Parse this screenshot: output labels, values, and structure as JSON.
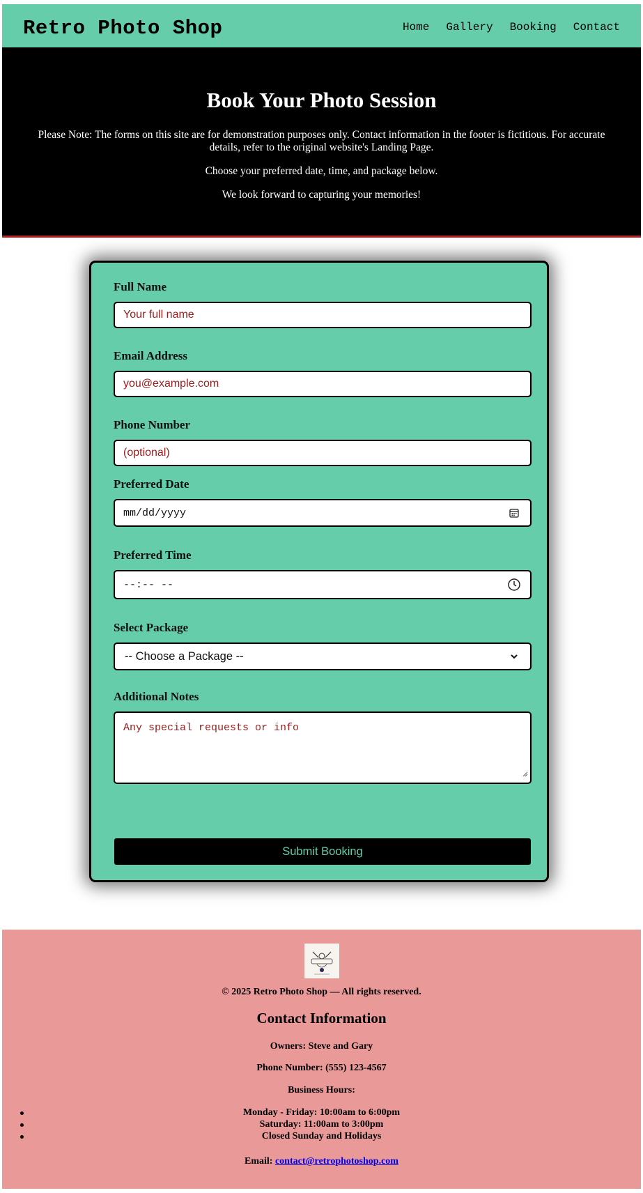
{
  "header": {
    "brand": "Retro Photo Shop",
    "nav": [
      "Home",
      "Gallery",
      "Booking",
      "Contact"
    ]
  },
  "hero": {
    "title": "Book Your Photo Session",
    "note": "Please Note: The forms on this site are for demonstration purposes only. Contact information in the footer is fictitious. For accurate details, refer to the original website's Landing Page.",
    "line2": "Choose your preferred date, time, and package below.",
    "line3": "We look forward to capturing your memories!"
  },
  "form": {
    "name_label": "Full Name",
    "name_placeholder": "Your full name",
    "email_label": "Email Address",
    "email_placeholder": "you@example.com",
    "phone_label": "Phone Number",
    "phone_placeholder": "(optional)",
    "date_label": "Preferred Date",
    "date_placeholder": "mm/dd/yyyy",
    "time_label": "Preferred Time",
    "time_placeholder": "--:-- --",
    "package_label": "Select Package",
    "package_selected": "-- Choose a Package --",
    "notes_label": "Additional Notes",
    "notes_placeholder": "Any special requests or info",
    "submit_label": "Submit Booking"
  },
  "footer": {
    "copyright": "© 2025 Retro Photo Shop — All rights reserved.",
    "contact_title": "Contact Information",
    "owners": "Owners: Steve and Gary",
    "phone": "Phone Number: (555) 123-4567",
    "hours_title": "Business Hours:",
    "hours": [
      "Monday - Friday: 10:00am to 6:00pm",
      "Saturday: 11:00am to 3:00pm",
      "Closed Sunday and Holidays"
    ],
    "email_label": "Email:",
    "email": "contact@retrophotoshop.com"
  },
  "colors": {
    "header_bg": "#66cdaa",
    "hero_bg": "#000000",
    "footer_bg": "#ea9999",
    "placeholder": "#9b1c1c"
  }
}
